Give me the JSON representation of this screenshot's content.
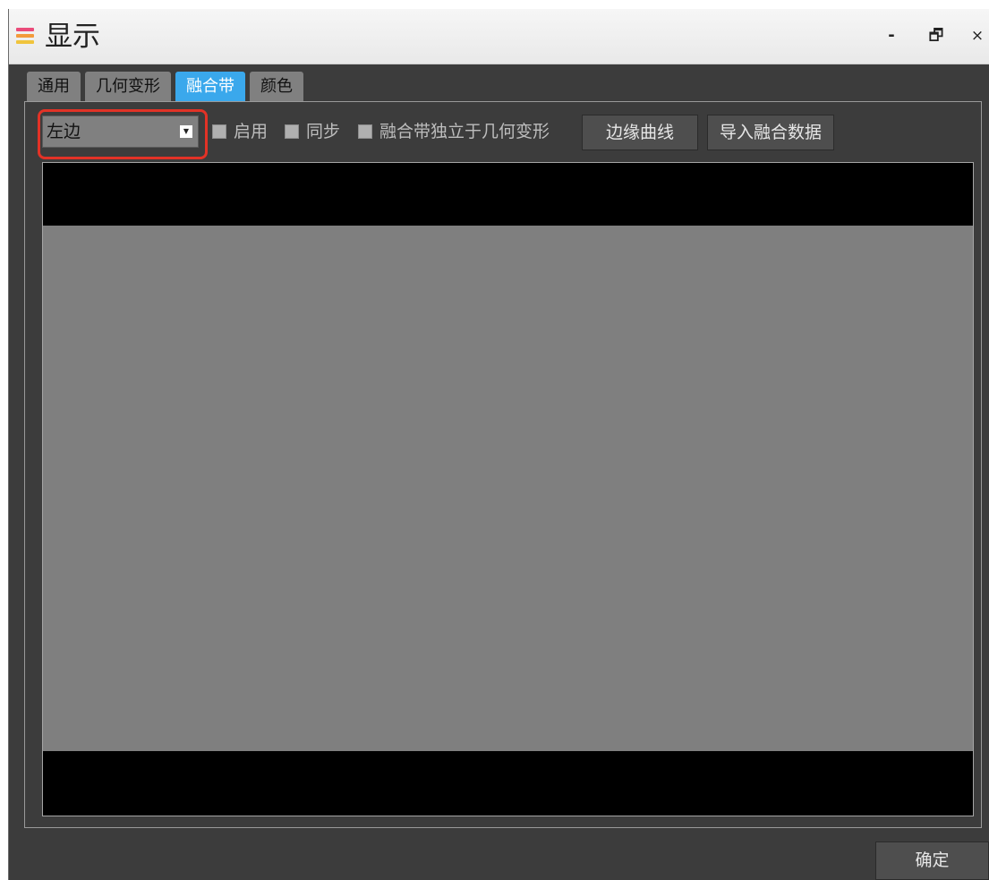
{
  "window": {
    "title": "显示",
    "icon": "layered-stripes-app-icon"
  },
  "window_controls": {
    "minimize": "-",
    "restore": "🗗",
    "close": "×"
  },
  "tabs": [
    {
      "label": "通用",
      "active": false
    },
    {
      "label": "几何变形",
      "active": false
    },
    {
      "label": "融合带",
      "active": true
    },
    {
      "label": "颜色",
      "active": false
    }
  ],
  "toolbar": {
    "edge_select": {
      "value": "左边",
      "highlighted": true,
      "highlight_color": "#e23226"
    },
    "checkboxes": [
      {
        "label": "启用",
        "checked": false
      },
      {
        "label": "同步",
        "checked": false
      },
      {
        "label": "融合带独立于几何变形",
        "checked": false
      }
    ],
    "edge_curve_button": "边缘曲线",
    "import_button": "导入融合数据"
  },
  "footer": {
    "ok_button": "确定"
  },
  "colors": {
    "accent": "#3aa8ec",
    "highlight": "#e23226",
    "background": "#3c3c3c",
    "preview": "#7f7f7f"
  }
}
